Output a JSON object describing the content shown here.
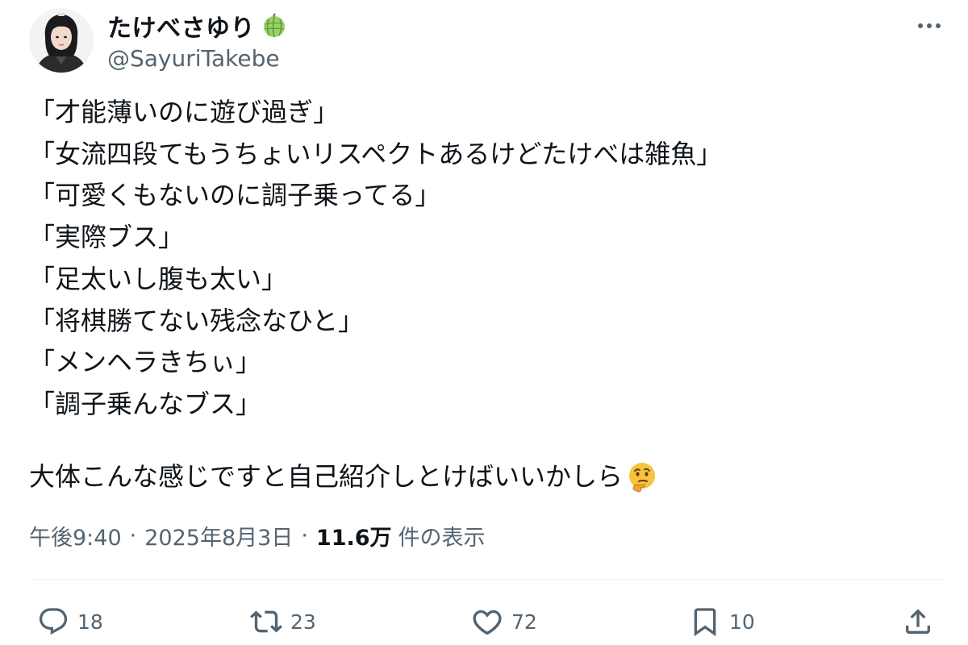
{
  "author": {
    "display_name": "たけべさゆり",
    "handle": "@SayuriTakebe",
    "name_emoji": "melon-icon"
  },
  "tweet": {
    "lines": [
      "「才能薄いのに遊び過ぎ」",
      "「女流四段てもうちょいリスペクトあるけどたけべは雑魚」",
      "「可愛くもないのに調子乗ってる」",
      "「実際ブス」",
      "「足太いし腹も太い」",
      "「将棋勝てない残念なひと」",
      "「メンヘラきちぃ」",
      "「調子乗んなブス」"
    ],
    "last_line": "大体こんな感じですと自己紹介しとけばいいかしら",
    "last_line_emoji": "thinking-face-icon"
  },
  "meta": {
    "time": "午後9:40",
    "separator": "·",
    "date": "2025年8月3日",
    "views_count": "11.6万",
    "views_label": "件の表示"
  },
  "actions": {
    "reply_count": "18",
    "retweet_count": "23",
    "like_count": "72",
    "bookmark_count": "10"
  },
  "colors": {
    "text_primary": "#0f1419",
    "text_secondary": "#536471",
    "divider": "#eff3f4"
  }
}
